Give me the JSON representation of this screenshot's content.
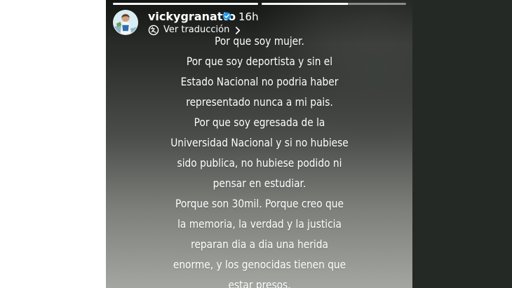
{
  "story": {
    "username": "vickygranatto",
    "time_ago": "16h",
    "translation_label": "Ver traducción",
    "verified_icon": "verified-icon",
    "translate_icon": "translate-icon",
    "chevron_icon": "chevron-right-icon",
    "progress": [
      1,
      0.6
    ],
    "text_lines": [
      "Por que soy mujer.",
      "Por que soy deportista y sin el",
      "Estado Nacional no podria haber",
      "representado nunca a mi pais.",
      "Por que soy egresada de la",
      "Universidad Nacional y si no hubiese",
      "sido publica, no hubiese podido ni",
      "pensar en estudiar.",
      "Porque son 30mil. Porque creo que",
      "la memoria, la verdad y la justicia",
      "reparan dia a dia una herida",
      "enorme, y los genocidas tienen que",
      "estar presos."
    ]
  },
  "colors": {
    "background": "#ffffff",
    "right_panel": "#252925",
    "text": "#ffffff",
    "verified": "#1d9bf0"
  }
}
